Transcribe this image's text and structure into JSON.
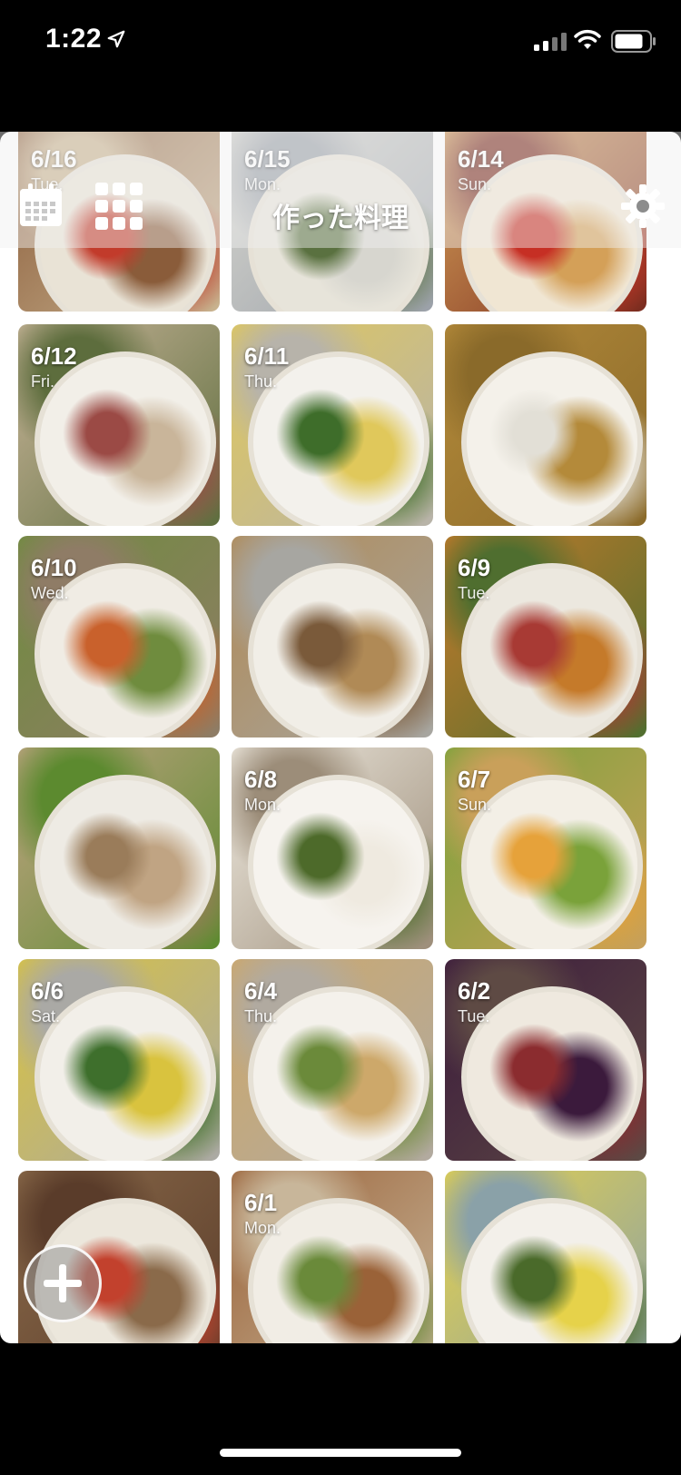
{
  "status_bar": {
    "time": "1:22",
    "icons": [
      "location-arrow-icon",
      "cellular-signal-icon",
      "wifi-icon",
      "battery-icon"
    ]
  },
  "toolbar": {
    "title": "作った料理",
    "left_icons": [
      "calendar-icon",
      "grid-view-icon"
    ],
    "right_icons": [
      "gear-icon"
    ]
  },
  "tiles": [
    {
      "date": "6/16",
      "dow": "Tue."
    },
    {
      "date": "6/15",
      "dow": "Mon."
    },
    {
      "date": "6/14",
      "dow": "Sun."
    },
    {
      "date": "6/12",
      "dow": "Fri."
    },
    {
      "date": "6/11",
      "dow": "Thu."
    },
    {
      "date": "",
      "dow": ""
    },
    {
      "date": "6/10",
      "dow": "Wed."
    },
    {
      "date": "",
      "dow": ""
    },
    {
      "date": "6/9",
      "dow": "Tue."
    },
    {
      "date": "",
      "dow": ""
    },
    {
      "date": "6/8",
      "dow": "Mon."
    },
    {
      "date": "6/7",
      "dow": "Sun."
    },
    {
      "date": "6/6",
      "dow": "Sat."
    },
    {
      "date": "6/4",
      "dow": "Thu."
    },
    {
      "date": "6/2",
      "dow": "Tue."
    },
    {
      "date": "",
      "dow": ""
    },
    {
      "date": "6/1",
      "dow": "Mon."
    },
    {
      "date": "",
      "dow": ""
    }
  ],
  "fab": {
    "icon": "plus-icon"
  },
  "colors": {
    "background": "#000000",
    "surface": "#ffffff",
    "toolbar_overlay": "rgba(240,240,240,0.45)"
  }
}
